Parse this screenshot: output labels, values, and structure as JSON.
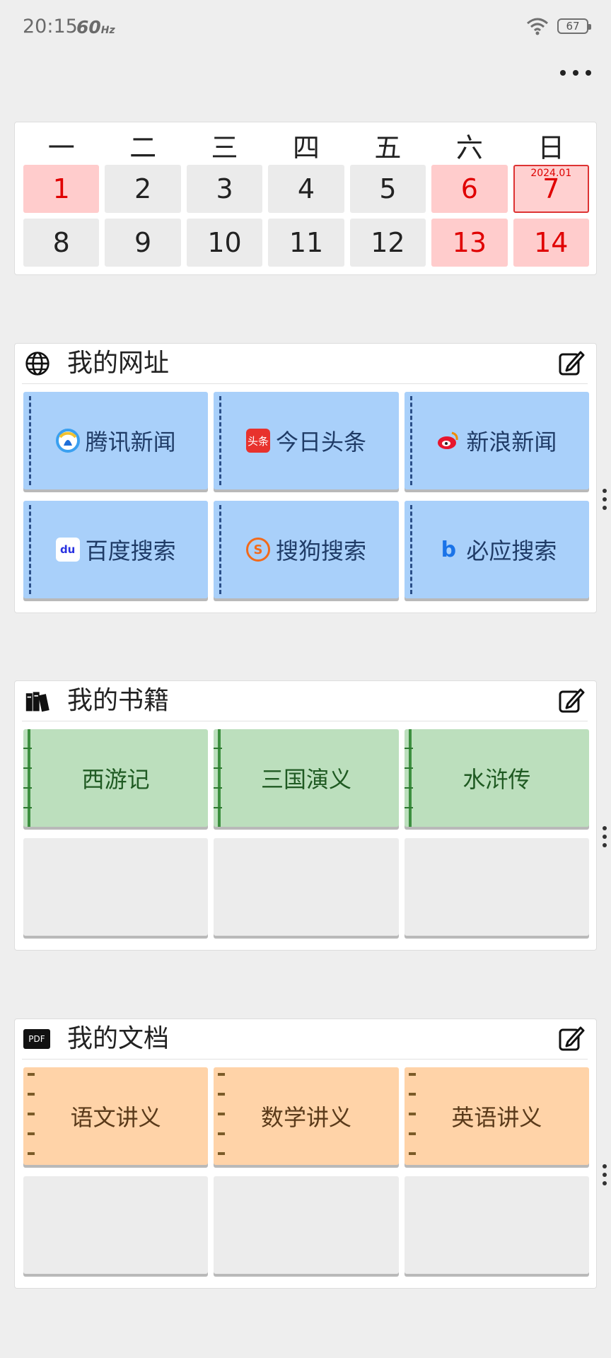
{
  "status_bar": {
    "time": "20:15",
    "refresh": "60",
    "refresh_unit": "Hz",
    "battery": "67"
  },
  "calendar": {
    "weekdays": [
      "一",
      "二",
      "三",
      "四",
      "五",
      "六",
      "日"
    ],
    "days": [
      {
        "day": "1",
        "style": "weekend"
      },
      {
        "day": "2",
        "style": "normal"
      },
      {
        "day": "3",
        "style": "normal"
      },
      {
        "day": "4",
        "style": "normal"
      },
      {
        "day": "5",
        "style": "normal"
      },
      {
        "day": "6",
        "style": "weekend"
      },
      {
        "day": "7",
        "style": "today",
        "month_tag": "2024.01"
      },
      {
        "day": "8",
        "style": "normal"
      },
      {
        "day": "9",
        "style": "normal"
      },
      {
        "day": "10",
        "style": "normal"
      },
      {
        "day": "11",
        "style": "normal"
      },
      {
        "day": "12",
        "style": "normal"
      },
      {
        "day": "13",
        "style": "weekend"
      },
      {
        "day": "14",
        "style": "weekend"
      }
    ]
  },
  "websites": {
    "title": "我的网址",
    "icon": "globe-icon",
    "items": [
      {
        "label": "腾讯新闻",
        "icon": "tencent-news-icon"
      },
      {
        "label": "今日头条",
        "icon": "toutiao-icon",
        "icon_text": "头条"
      },
      {
        "label": "新浪新闻",
        "icon": "sina-weibo-icon"
      },
      {
        "label": "百度搜索",
        "icon": "baidu-icon",
        "icon_text": "du"
      },
      {
        "label": "搜狗搜索",
        "icon": "sogou-icon",
        "icon_text": "S"
      },
      {
        "label": "必应搜索",
        "icon": "bing-icon",
        "icon_text": "b"
      }
    ]
  },
  "books": {
    "title": "我的书籍",
    "icon": "books-icon",
    "items": [
      "西游记",
      "三国演义",
      "水浒传",
      "",
      "",
      ""
    ]
  },
  "docs": {
    "title": "我的文档",
    "icon": "pdf-icon",
    "icon_text": "PDF",
    "items": [
      "语文讲义",
      "数学讲义",
      "英语讲义",
      "",
      "",
      ""
    ]
  },
  "colors": {
    "weekend_bg": "#ffcccc",
    "weekend_text": "#e00000",
    "web_tile": "#a9d0fa",
    "book_tile": "#bcdfbd",
    "doc_tile": "#ffd3a8",
    "empty_tile": "#ececec"
  }
}
